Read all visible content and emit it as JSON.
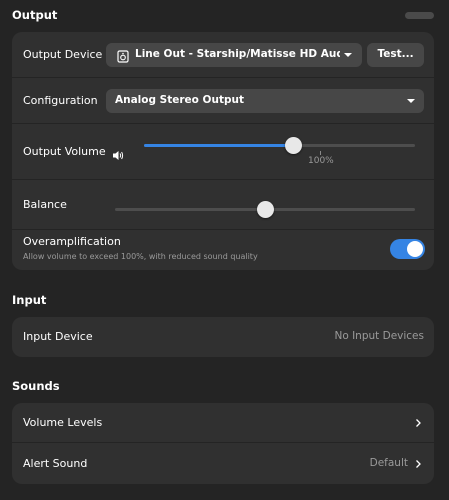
{
  "output": {
    "section_title": "Output",
    "device_label": "Output Device",
    "device_value": "Line Out - Starship/Matisse HD Audio C...",
    "test_button": "Test...",
    "configuration_label": "Configuration",
    "configuration_value": "Analog Stereo Output",
    "volume_label": "Output Volume",
    "volume_level": 0.55,
    "volume_mark": "100%",
    "balance_label": "Balance",
    "balance_level": 0.5,
    "overamp_label": "Overamplification",
    "overamp_sub": "Allow volume to exceed 100%, with reduced sound quality",
    "overamp_enabled": true
  },
  "input": {
    "section_title": "Input",
    "device_label": "Input Device",
    "device_value": "No Input Devices"
  },
  "sounds": {
    "section_title": "Sounds",
    "volume_levels_label": "Volume Levels",
    "alert_sound_label": "Alert Sound",
    "alert_sound_value": "Default"
  },
  "colors": {
    "accent": "#3584e4",
    "background": "#242424",
    "card": "#303030"
  }
}
